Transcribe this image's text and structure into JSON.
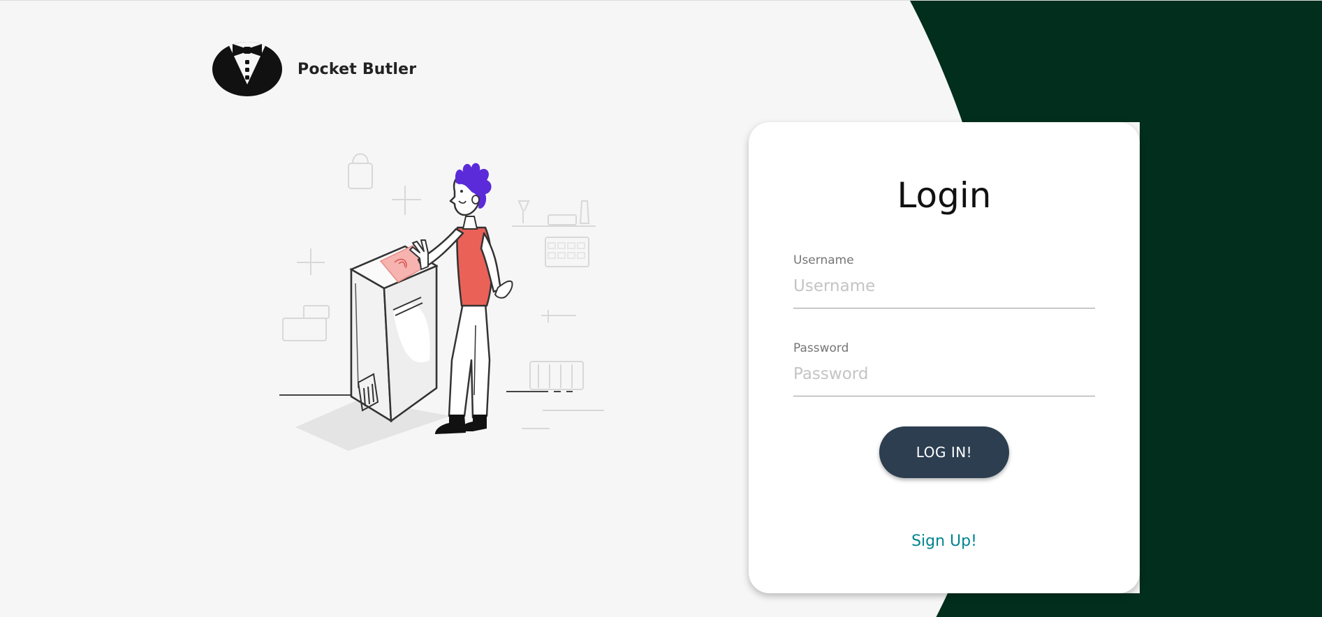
{
  "brand": {
    "name": "Pocket Butler",
    "logo_icon": "tuxedo-bowtie-icon"
  },
  "illustration": {
    "icon": "person-fingerprint-scanner-illustration"
  },
  "colors": {
    "background": "#f6f6f6",
    "accent_dark_green": "#012e1d",
    "button": "#2c3e50",
    "link": "#00838f",
    "hair": "#5b2bd9",
    "shirt": "#ea6158"
  },
  "login": {
    "title": "Login",
    "username": {
      "label": "Username",
      "placeholder": "Username",
      "value": ""
    },
    "password": {
      "label": "Password",
      "placeholder": "Password",
      "value": ""
    },
    "submit_label": "LOG IN!",
    "signup_label": "Sign Up!"
  }
}
